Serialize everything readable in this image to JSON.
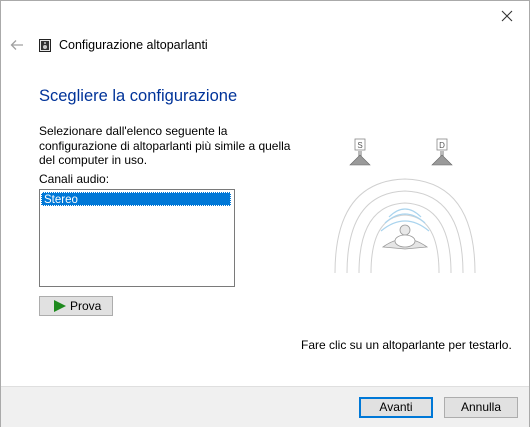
{
  "window": {
    "title": "Configurazione altoparlanti",
    "close_icon": "close-icon",
    "back_icon": "back-arrow-icon",
    "app_icon": "speaker-icon"
  },
  "main": {
    "heading": "Scegliere la configurazione",
    "description": "Selezionare dall'elenco seguente la configurazione di altoparlanti più simile a quella del computer in uso.",
    "channels_label": "Canali audio:",
    "channels": [
      "Stereo"
    ],
    "selected_channel": "Stereo",
    "test_button": "Prova",
    "hint": "Fare clic su un altoparlante per testarlo.",
    "speakers": [
      {
        "label": "S"
      },
      {
        "label": "D"
      }
    ]
  },
  "footer": {
    "next_button": "Avanti",
    "cancel_button": "Annulla"
  },
  "colors": {
    "heading": "#003399",
    "selection": "#0078d7",
    "play": "#1e8a1e"
  }
}
